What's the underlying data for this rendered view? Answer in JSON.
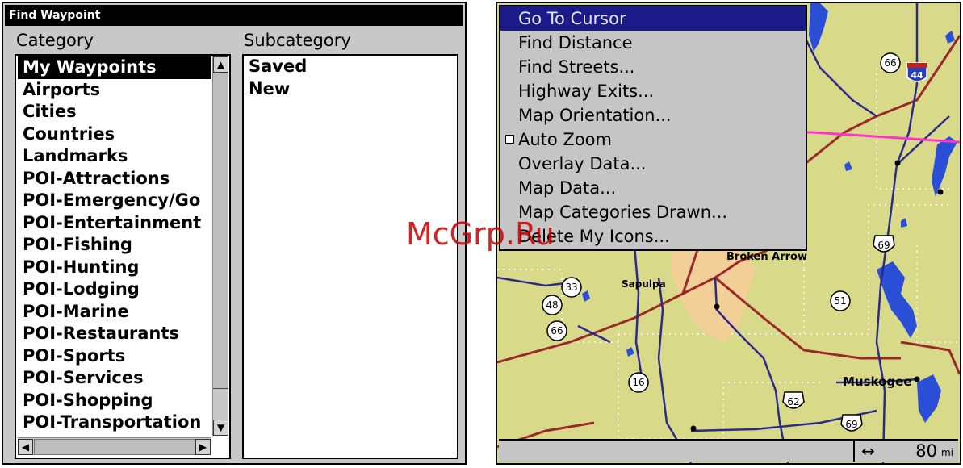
{
  "left_panel": {
    "title": "Find Waypoint",
    "category_header": "Category",
    "subcategory_header": "Subcategory",
    "categories": [
      "My Waypoints",
      "Airports",
      "Cities",
      "Countries",
      "Landmarks",
      "POI-Attractions",
      "POI-Emergency/Go",
      "POI-Entertainment",
      "POI-Fishing",
      "POI-Hunting",
      "POI-Lodging",
      "POI-Marine",
      "POI-Restaurants",
      "POI-Sports",
      "POI-Services",
      "POI-Shopping",
      "POI-Transportation"
    ],
    "selected_category": "My Waypoints",
    "subcategories": [
      "Saved",
      "New"
    ]
  },
  "map_panel": {
    "menu_items": [
      {
        "label": "Go To Cursor",
        "highlighted": true
      },
      {
        "label": "Find Distance"
      },
      {
        "label": "Find Streets..."
      },
      {
        "label": "Highway Exits..."
      },
      {
        "label": "Map Orientation..."
      },
      {
        "label": "Auto Zoom",
        "checkbox": true,
        "checked": false
      },
      {
        "label": "Overlay Data..."
      },
      {
        "label": "Map Data..."
      },
      {
        "label": "Map Categories Drawn..."
      },
      {
        "label": "Delete My Icons..."
      }
    ],
    "places": {
      "broken_arrow": "Broken Arrow",
      "sapulpa": "Sapulpa",
      "muskogee": "Muskogee"
    },
    "shields": {
      "i44": "44",
      "r66_top": "66",
      "r69_mid": "69",
      "r33": "33",
      "r48": "48",
      "r66_left": "66",
      "r51": "51",
      "r16": "16",
      "r62": "62",
      "r69_bottom": "69"
    },
    "zoom": {
      "value": "80",
      "unit": "mi",
      "arrow": "↔"
    }
  },
  "watermark": "McGrp.Ru",
  "colors": {
    "map_land": "#d9d98a",
    "water": "#2a4fd6",
    "road_major": "#9a2a2a",
    "road_minor": "#2a2a8a",
    "route_line": "#ff33cc",
    "menu_highlight": "#1a1a8a"
  }
}
